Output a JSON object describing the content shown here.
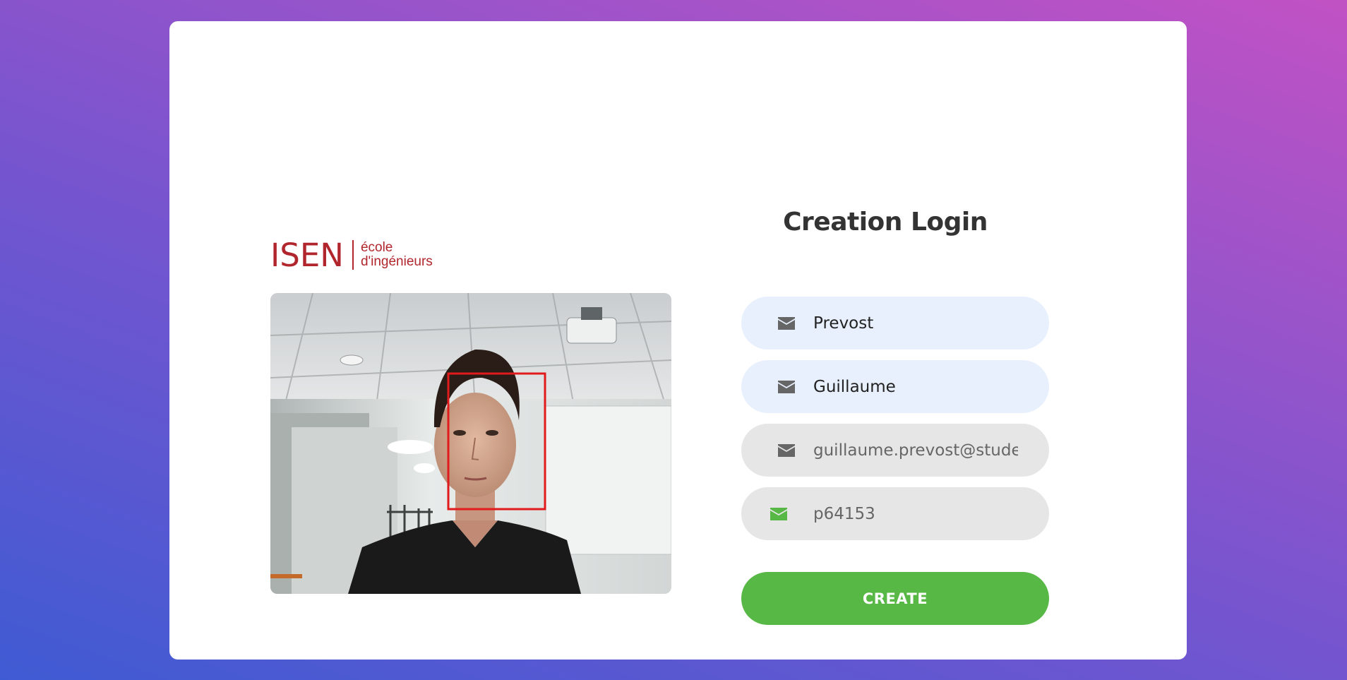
{
  "brand": {
    "logo_main": "ISEN",
    "logo_sub_line1": "école",
    "logo_sub_line2": "d'ingénieurs",
    "color": "#b1262d"
  },
  "form": {
    "title": "Creation Login",
    "fields": [
      {
        "name": "last-name",
        "value": "Prevost",
        "icon": "envelope-icon",
        "state": "autofilled"
      },
      {
        "name": "first-name",
        "value": "Guillaume",
        "icon": "envelope-icon",
        "state": "autofilled"
      },
      {
        "name": "email",
        "value": "guillaume.prevost@stude",
        "icon": "envelope-icon",
        "state": "normal"
      },
      {
        "name": "password",
        "value": "p64153",
        "icon": "envelope-icon",
        "state": "focused"
      }
    ],
    "submit_label": "CREATE"
  },
  "colors": {
    "accent_green": "#57b846",
    "autofill_bg": "#e8f0fe",
    "input_bg": "#e6e6e6",
    "face_box": "#e11b1b"
  },
  "webcam": {
    "face_detected": true
  }
}
